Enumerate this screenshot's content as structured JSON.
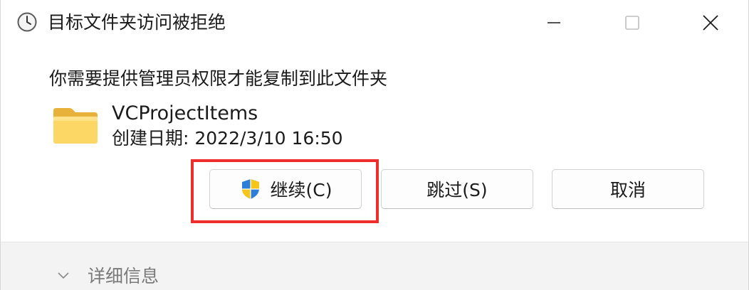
{
  "window": {
    "title": "目标文件夹访问被拒绝",
    "title_icon": "clock-icon",
    "controls": {
      "minimize_icon": "minimize-icon",
      "maximize_icon": "maximize-icon",
      "close_icon": "close-icon"
    }
  },
  "dialog": {
    "message": "你需要提供管理员权限才能复制到此文件夹",
    "item": {
      "icon": "folder-icon",
      "name": "VCProjectItems",
      "date_label": "创建日期: ",
      "date_value": "2022/3/10 16:50"
    },
    "buttons": {
      "continue": "继续(C)",
      "continue_icon": "uac-shield-icon",
      "skip": "跳过(S)",
      "cancel": "取消"
    },
    "highlight_color": "#f02d2d"
  },
  "footer": {
    "details_label": "详细信息",
    "details_icon": "chevron-down-icon"
  }
}
